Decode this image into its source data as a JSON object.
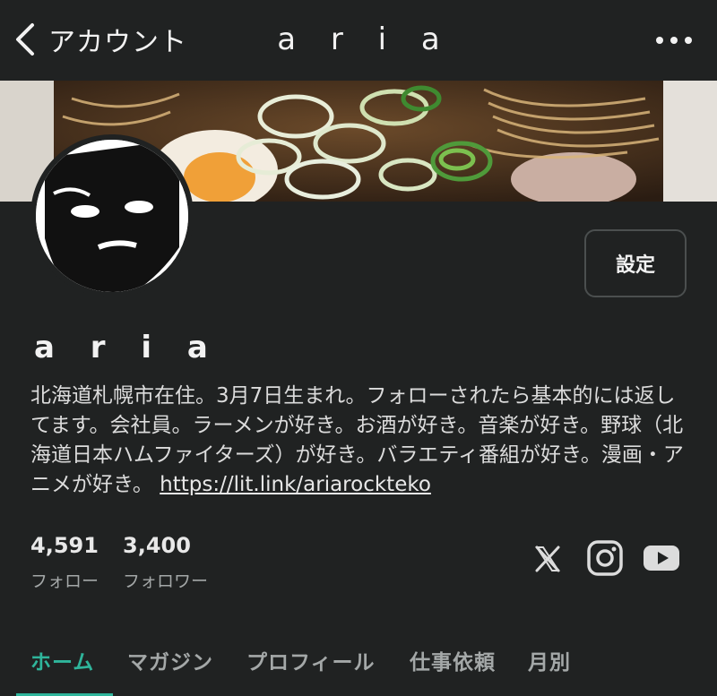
{
  "nav": {
    "back_label": "アカウント",
    "title": "a r i a"
  },
  "profile": {
    "settings_label": "設定",
    "name": "a r i a",
    "bio": "北海道札幌市在住。3月7日生まれ。フォローされたら基本的には返してます。会社員。ラーメンが好き。お酒が好き。音楽が好き。野球（北海道日本ハムファイターズ）が好き。バラエティ番組が好き。漫画・アニメが好き。",
    "link": "https://lit.link/ariarockteko"
  },
  "stats": {
    "following_count": "4,591",
    "following_label": "フォロー",
    "followers_count": "3,400",
    "followers_label": "フォロワー"
  },
  "social": [
    "x-icon",
    "instagram-icon",
    "youtube-icon"
  ],
  "tabs": [
    {
      "label": "ホーム",
      "active": true
    },
    {
      "label": "マガジン",
      "active": false
    },
    {
      "label": "プロフィール",
      "active": false
    },
    {
      "label": "仕事依頼",
      "active": false
    },
    {
      "label": "月別",
      "active": false
    }
  ],
  "colors": {
    "background": "#202222",
    "accent": "#2fb59b",
    "muted_text": "#a4a8a8"
  }
}
